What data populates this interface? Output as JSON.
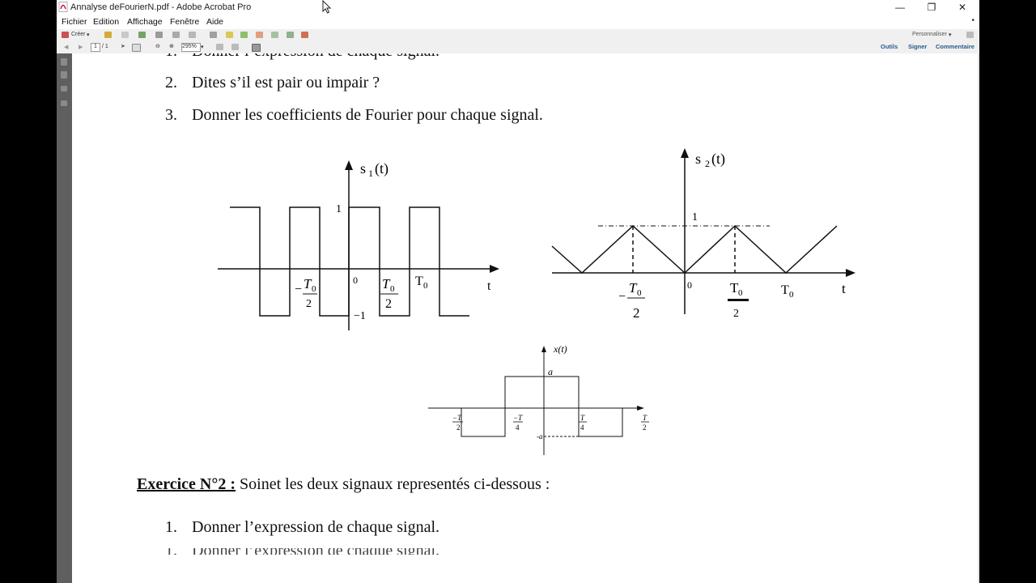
{
  "window": {
    "title": "Annalyse deFourierN.pdf - Adobe Acrobat Pro",
    "minimize": "—",
    "maximize": "❐",
    "close": "✕"
  },
  "menu": [
    "Fichier",
    "Edition",
    "Affichage",
    "Fenêtre",
    "Aide"
  ],
  "toolbar": {
    "create_label": "Créer",
    "customize_label": "Personnaliser",
    "page_current": "1",
    "page_total": "/ 1",
    "zoom": "295%",
    "tools_label": "Outils",
    "sign_label": "Signer",
    "comment_label": "Commentaire"
  },
  "document": {
    "top_partial": "Donner l’expression de chaque signal.",
    "items_top": [
      {
        "num": "2.",
        "text": "Dites s’il est pair ou impair ?"
      },
      {
        "num": "3.",
        "text": "Donner les coefficients de Fourier pour chaque signal."
      }
    ],
    "figure1": {
      "signal": "s",
      "sub": "1",
      "arg": "(t)",
      "one": "1",
      "minus_one": "−1",
      "zero": "0",
      "t": "t",
      "T0": "T",
      "T0sub": "0",
      "two": "2",
      "minus": "−"
    },
    "figure2": {
      "signal": "s",
      "sub": "2",
      "arg": "(t)",
      "one": "1",
      "zero": "0",
      "t": "t",
      "T0": "T",
      "T0sub": "0",
      "two": "2",
      "minus": "−"
    },
    "figure3": {
      "ylabel": "x(t)",
      "a": "a",
      "minus_a": "-a",
      "minus_T": "−T",
      "T": "T",
      "two": "2",
      "four": "4"
    },
    "exercise_title": "Exercice N°2 :",
    "exercise_text": " Soinet les deux signaux representés ci-dessous :",
    "items_bottom": [
      {
        "num": "1.",
        "text": "Donner l’expression de chaque signal."
      }
    ],
    "bottom_partial": "Donner l’expression de chaque signal."
  }
}
